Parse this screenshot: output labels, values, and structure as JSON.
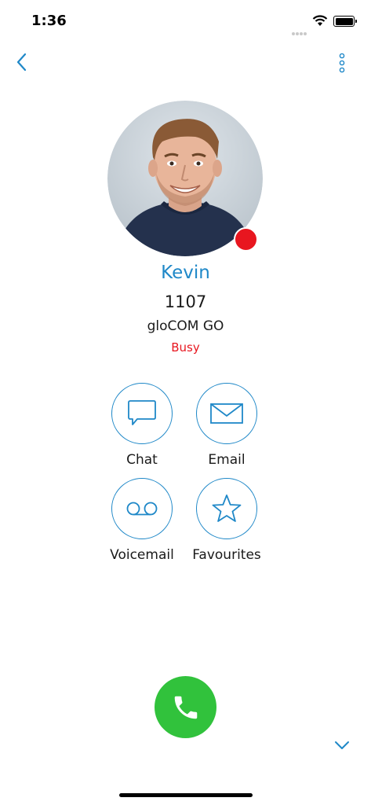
{
  "status_bar": {
    "time": "1:36"
  },
  "contact": {
    "name": "Kevin",
    "extension": "1107",
    "app": "gloCOM GO",
    "presence": "Busy",
    "presence_color": "#e8161f"
  },
  "actions": [
    {
      "label": "Chat",
      "icon": "chat-bubble-icon"
    },
    {
      "label": "Email",
      "icon": "envelope-icon"
    },
    {
      "label": "Voicemail",
      "icon": "voicemail-icon"
    },
    {
      "label": "Favourites",
      "icon": "star-icon"
    }
  ],
  "colors": {
    "accent": "#1f88c8",
    "call": "#31c23c",
    "busy": "#e8161f"
  }
}
